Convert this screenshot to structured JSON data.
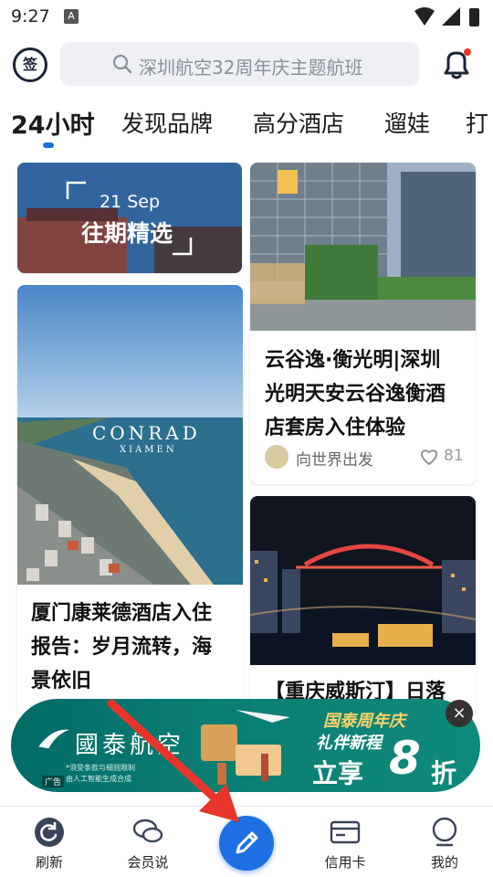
{
  "status_bar": {
    "time": "9:27",
    "a_badge": "A"
  },
  "header": {
    "sign_label": "签",
    "search_placeholder": "深圳航空32周年庆主题航班"
  },
  "tabs": [
    {
      "label": "24小时"
    },
    {
      "label": "发现品牌"
    },
    {
      "label": "高分酒店"
    },
    {
      "label": "遛娃"
    },
    {
      "label": "打"
    }
  ],
  "feed": {
    "banner": {
      "date": "21 Sep",
      "label": "往期精选"
    },
    "left_card": {
      "title_lines": [
        "厦门康莱德酒店入住",
        "报告：岁月流转，海",
        "景依旧"
      ],
      "hotel_brand": "CONRAD",
      "hotel_city": "XIAMEN"
    },
    "right_card_1": {
      "title_lines": [
        "云谷逸·衡光明|深圳",
        "光明天安云谷逸衡酒",
        "店套房入住体验"
      ],
      "author": "向世界出发",
      "likes": "81"
    },
    "right_card_2": {
      "title_partial": "【重庆威斯汀】日落"
    }
  },
  "ad": {
    "brand": "國泰航空",
    "headline": "国泰周年庆",
    "subline": "礼伴新程",
    "offer": "立享",
    "discount": "8",
    "discount_unit": "折",
    "fineprint_1": "*须受条款与细则限制",
    "fineprint_2": "由人工智能生成合成",
    "ad_tag": "广告",
    "close": "×"
  },
  "bottom_nav": {
    "refresh": "刷新",
    "members": "会员说",
    "credit": "信用卡",
    "mine": "我的"
  },
  "colors": {
    "accent": "#1e6fe4",
    "ad_teal": "#0a7d72",
    "arrow_red": "#e8352b"
  }
}
